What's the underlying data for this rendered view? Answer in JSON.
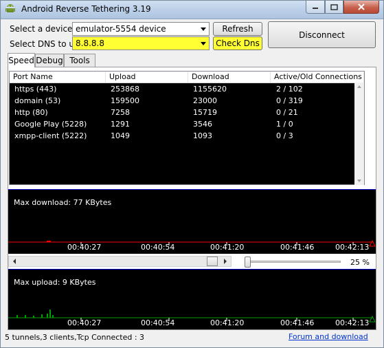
{
  "window": {
    "title": "Android Reverse Tethering 3.19"
  },
  "device_label": "Select a device",
  "device_value": "emulator-5554  device",
  "dns_label": "Select DNS to use",
  "dns_value": "8.8.8.8",
  "refresh_label": "Refresh",
  "check_dns_label": "Check Dns",
  "disconnect_label": "Disconnect",
  "tabs": [
    "Speed",
    "Debug",
    "Tools"
  ],
  "columns": [
    "Port Name",
    "Upload",
    "Download",
    "Active/Old Connections"
  ],
  "rows": [
    [
      "https (443)",
      "253868",
      "1155620",
      "2 / 102"
    ],
    [
      "domain (53)",
      "159500",
      "23000",
      "0 / 319"
    ],
    [
      "http (80)",
      "7258",
      "15719",
      "0 / 21"
    ],
    [
      "Google Play (5228)",
      "1291",
      "3546",
      "1 / 0"
    ],
    [
      "xmpp-client (5222)",
      "1049",
      "1093",
      "0 / 3"
    ]
  ],
  "download_graph": {
    "label": "Max download: 77 KBytes",
    "times": [
      "00:40:27",
      "00:40:54",
      "00:41:20",
      "00:41:46",
      "00:42:13"
    ]
  },
  "zoom": {
    "level_pct": 25,
    "text": "25 %"
  },
  "upload_graph": {
    "label": "Max upload: 9 KBytes",
    "times": [
      "00:40:27",
      "00:40:54",
      "00:41:20",
      "00:41:46",
      "00:42:13"
    ]
  },
  "status_text": "5 tunnels,3 clients,Tcp Connected : 3",
  "forum_link": "Forum and download",
  "colors": {
    "highlight": "#ffff33",
    "graph_bg": "#000000",
    "download_line": "#ff0000",
    "upload_line": "#00a000"
  }
}
